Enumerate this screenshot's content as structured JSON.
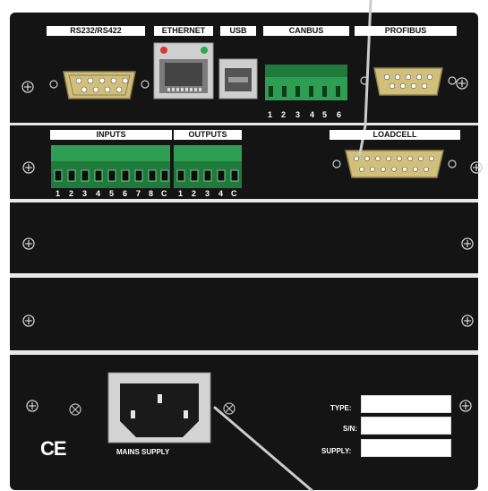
{
  "top_panel": {
    "labels": {
      "rs232": "RS232/RS422",
      "ethernet": "ETHERNET",
      "usb": "USB",
      "canbus": "CANBUS",
      "profibus": "PROFIBUS"
    },
    "canbus_pins": [
      "1",
      "2",
      "3",
      "4",
      "5",
      "6"
    ]
  },
  "io_panel": {
    "labels": {
      "inputs": "INPUTS",
      "outputs": "OUTPUTS",
      "loadcell": "LOADCELL"
    },
    "input_pins": [
      "1",
      "2",
      "3",
      "4",
      "5",
      "6",
      "7",
      "8",
      "C"
    ],
    "output_pins": [
      "1",
      "2",
      "3",
      "4",
      "C"
    ]
  },
  "bottom_panel": {
    "mains_label": "MAINS SUPPLY",
    "ce_mark": "CE",
    "fields": [
      {
        "label": "TYPE:",
        "value": ""
      },
      {
        "label": "S/N:",
        "value": ""
      },
      {
        "label": "SUPPLY:",
        "value": ""
      }
    ]
  },
  "colors": {
    "panel": "#141414",
    "terminal_green": "#2e9e52",
    "dsub_gold": "#d2c07a",
    "label_bg": "#ffffff"
  },
  "icons": [
    "screw-icon",
    "ground-icon",
    "ce-mark-icon",
    "iec-socket-icon",
    "dsub-connector-icon",
    "rj45-jack-icon",
    "usb-port-icon"
  ]
}
